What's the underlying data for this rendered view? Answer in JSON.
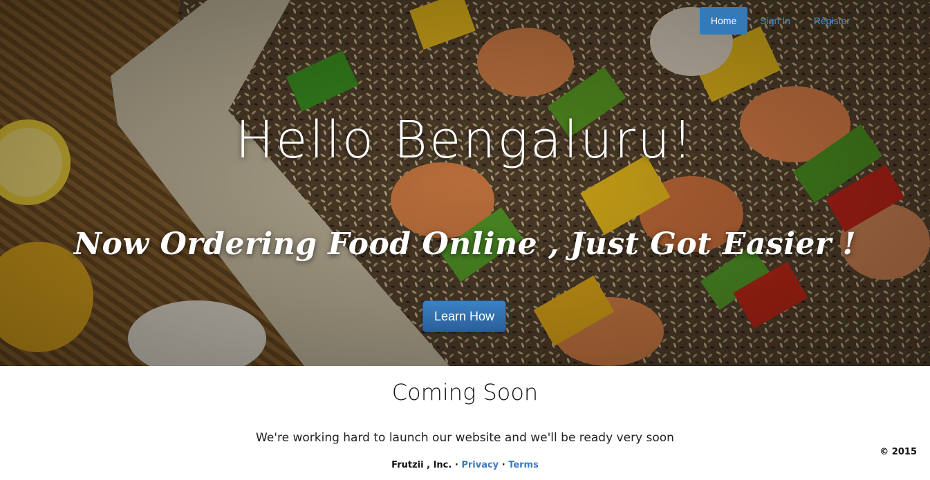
{
  "nav": {
    "home": "Home",
    "sign_in": "Sign In",
    "register": "Register"
  },
  "hero": {
    "title": "Hello Bengaluru!",
    "subtitle": "Now Ordering Food Online , Just Got Easier !",
    "button": "Learn How"
  },
  "content": {
    "heading": "Coming Soon",
    "message": "We're working hard to launch our website and we'll be ready very soon"
  },
  "footer": {
    "company": "Frutzii , Inc.",
    "separator": "·",
    "privacy": "Privacy",
    "terms": "Terms",
    "copyright": "© 2015"
  },
  "colors": {
    "accent": "#337ab7",
    "link": "#3a8ee0",
    "hero_text": "#ffffff"
  }
}
